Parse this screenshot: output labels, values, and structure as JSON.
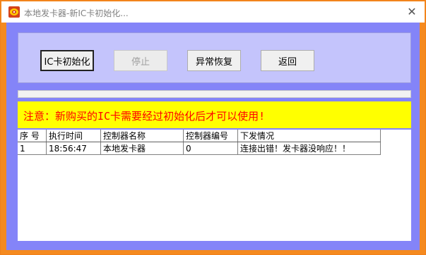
{
  "window": {
    "title": "本地发卡器-新IC卡初始化...",
    "close_glyph": "✕",
    "frame_color": "#f58a1f"
  },
  "toolbar": {
    "init_label": "IC卡初始化",
    "stop_label": "停止",
    "recover_label": "异常恢复",
    "back_label": "返回"
  },
  "notice": {
    "text": "注意：新购买的IC卡需要经过初始化后才可以使用!",
    "color": "#ff0000",
    "background": "#ffff00"
  },
  "grid": {
    "columns": [
      "序 号",
      "执行时间",
      "控制器名称",
      "控制器编号",
      "下发情况"
    ],
    "rows": [
      [
        "1",
        "18:56:47",
        "本地发卡器",
        "0",
        "连接出错！发卡器没响应！！"
      ]
    ]
  },
  "colors": {
    "client_bg": "#8484f8",
    "panel_bg": "#c4c4fc"
  }
}
